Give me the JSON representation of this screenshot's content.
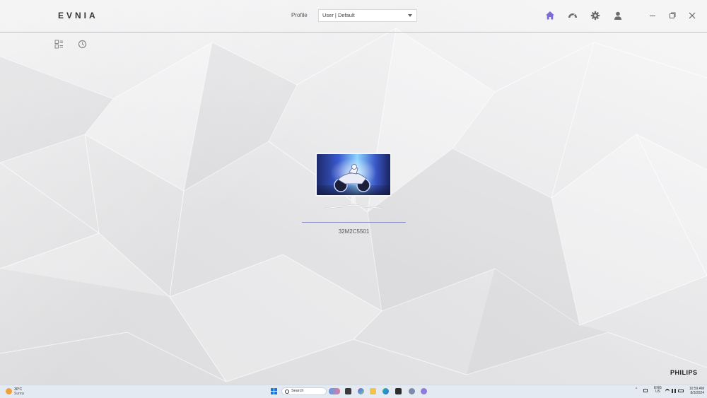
{
  "app": {
    "brand": "EVNIA",
    "profile_label": "Profile",
    "profile_value": "User | Default",
    "brand_logo": "PHILIPS",
    "accent_color": "#7b6cd8"
  },
  "header_icons": [
    "home-icon",
    "dashboard-icon",
    "settings-icon",
    "user-icon",
    "minimize-icon",
    "restore-icon",
    "close-icon"
  ],
  "sub_icons": [
    "grid-view-icon",
    "history-icon"
  ],
  "device": {
    "model": "32M2C5501"
  },
  "taskbar": {
    "weather_temp": "30°C",
    "weather_desc": "Sunny",
    "search_placeholder": "Search",
    "lang_line1": "ENG",
    "lang_line2": "US",
    "time": "10:59 AM",
    "date": "8/3/2024"
  }
}
